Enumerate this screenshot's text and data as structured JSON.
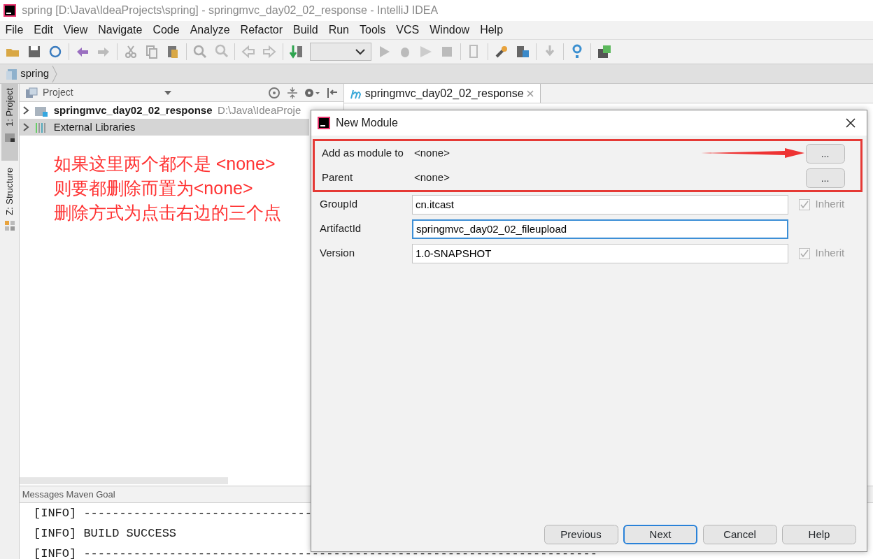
{
  "window": {
    "title": "spring [D:\\Java\\IdeaProjects\\spring] - springmvc_day02_02_response - IntelliJ IDEA"
  },
  "menu": [
    "File",
    "Edit",
    "View",
    "Navigate",
    "Code",
    "Analyze",
    "Refactor",
    "Build",
    "Run",
    "Tools",
    "VCS",
    "Window",
    "Help"
  ],
  "breadcrumb": [
    "spring"
  ],
  "side_tabs": [
    {
      "label": "1: Project",
      "selected": true
    },
    {
      "label": "Z: Structure",
      "selected": false
    }
  ],
  "project_panel": {
    "title": "Project",
    "items": [
      {
        "name": "springmvc_day02_02_response",
        "path": "D:\\Java\\IdeaProje",
        "selected": false
      },
      {
        "name": "External Libraries",
        "selected": true
      }
    ]
  },
  "annotation": {
    "lines": [
      "如果这里两个都不是 <none>",
      "则要都删除而置为<none>",
      "删除方式为点击右边的三个点"
    ]
  },
  "editor_tabs": [
    {
      "label": "springmvc_day02_02_response",
      "selected": true
    }
  ],
  "messages": {
    "title": "Messages Maven Goal",
    "lines": [
      "[INFO] --------------------------------",
      "[INFO] BUILD SUCCESS",
      "[INFO] ------------------------------------------------------------------------"
    ]
  },
  "dialog": {
    "title": "New Module",
    "parent_rows": [
      {
        "label": "Add as module to",
        "value": "<none>",
        "button": "..."
      },
      {
        "label": "Parent",
        "value": "<none>",
        "button": "..."
      }
    ],
    "fields": [
      {
        "label": "GroupId",
        "value": "cn.itcast",
        "focused": false,
        "inherit": {
          "label": "Inherit",
          "checked": true
        }
      },
      {
        "label": "ArtifactId",
        "value": "springmvc_day02_02_fileupload",
        "focused": true
      },
      {
        "label": "Version",
        "value": "1.0-SNAPSHOT",
        "focused": false,
        "inherit": {
          "label": "Inherit",
          "checked": true
        }
      }
    ],
    "buttons": [
      {
        "label": "Previous",
        "default": false
      },
      {
        "label": "Next",
        "default": true
      },
      {
        "label": "Cancel",
        "default": false
      },
      {
        "label": "Help",
        "default": false
      }
    ]
  }
}
